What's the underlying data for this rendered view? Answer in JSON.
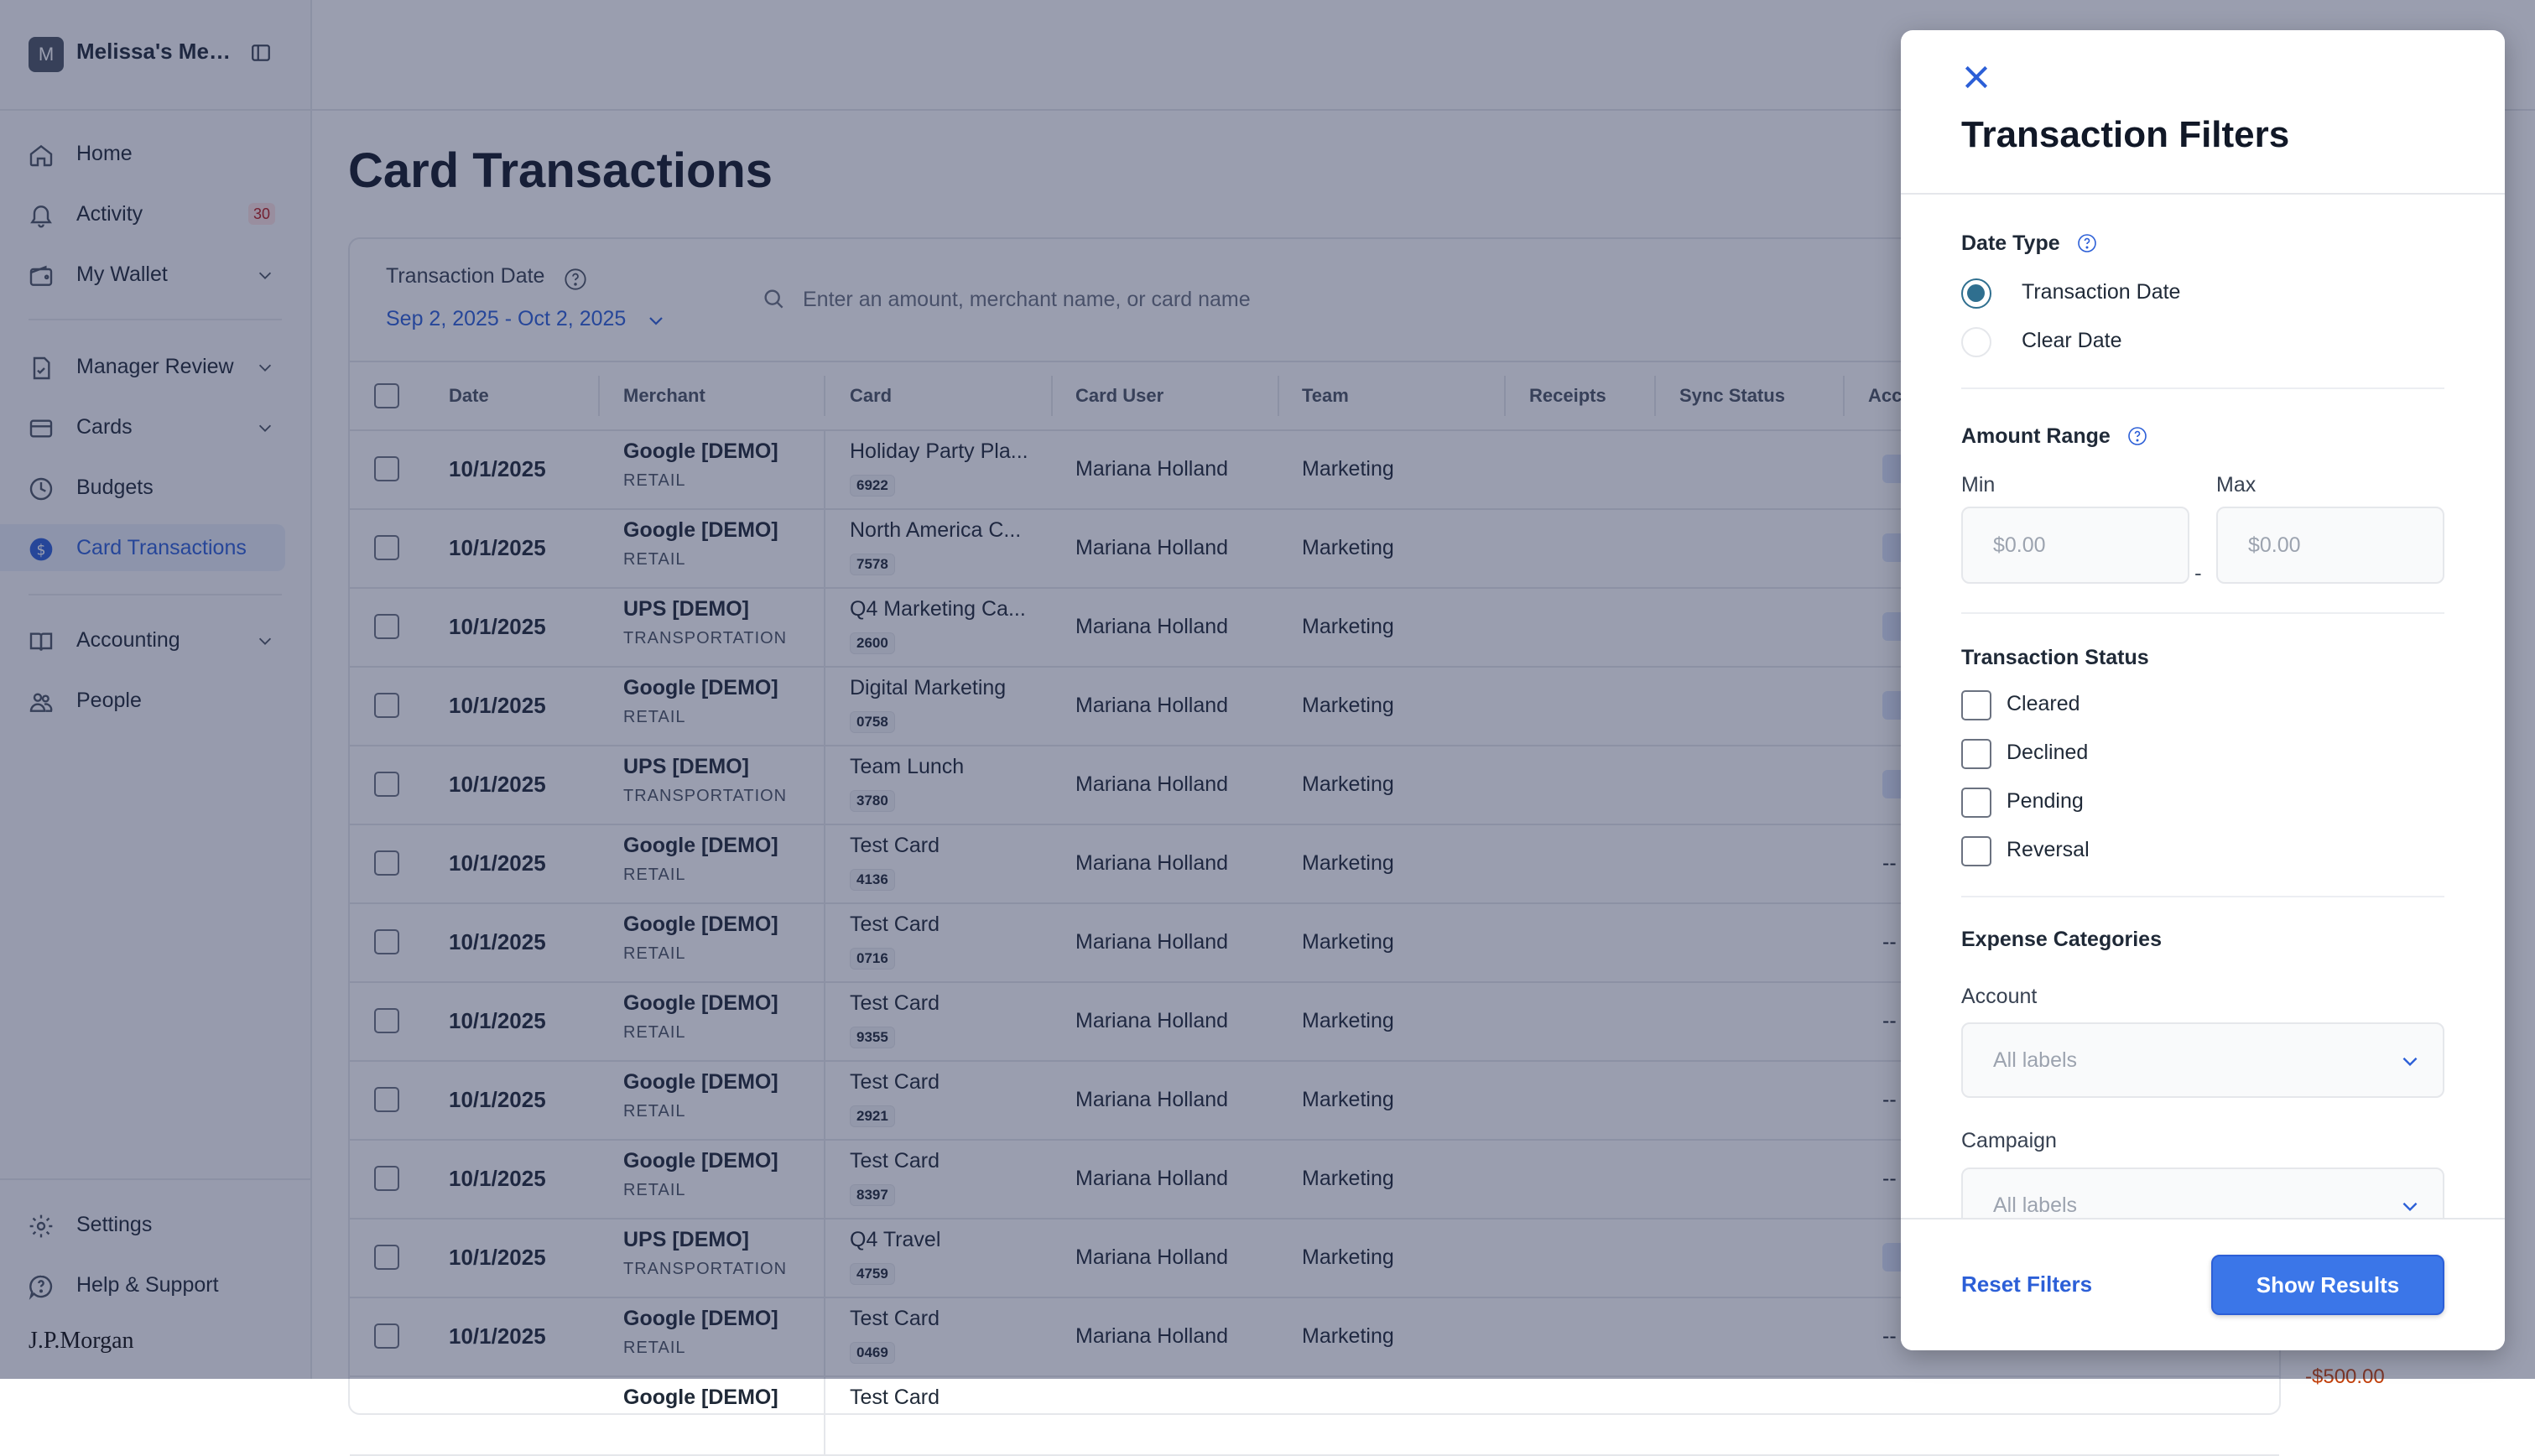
{
  "sidebar": {
    "org_initial": "M",
    "org_name": "Melissa's Mea...",
    "items": [
      {
        "label": "Home",
        "icon": "home-icon"
      },
      {
        "label": "Activity",
        "icon": "bell-icon",
        "badge": "30"
      },
      {
        "label": "My Wallet",
        "icon": "wallet-icon"
      },
      {
        "label": "Manager Review",
        "icon": "document-check-icon"
      },
      {
        "label": "Cards",
        "icon": "card-icon"
      },
      {
        "label": "Budgets",
        "icon": "pie-icon"
      },
      {
        "label": "Card Transactions",
        "icon": "dollar-circle-icon",
        "active": true
      },
      {
        "label": "Accounting",
        "icon": "book-icon"
      },
      {
        "label": "People",
        "icon": "people-icon"
      }
    ],
    "footer_items": [
      {
        "label": "Settings",
        "icon": "gear-icon"
      },
      {
        "label": "Help & Support",
        "icon": "help-icon"
      }
    ],
    "logo_text": "J.P.Morgan"
  },
  "page": {
    "title": "Card Transactions",
    "date_filter_label": "Transaction Date",
    "date_range": "Sep 2, 2025 - Oct 2, 2025",
    "search_placeholder": "Enter an amount, merchant name, or card name"
  },
  "table": {
    "columns": [
      "Date",
      "Merchant",
      "Card",
      "Card User",
      "Team",
      "Receipts",
      "Sync Status",
      "Acc"
    ],
    "rows": [
      {
        "date": "10/1/2025",
        "merchant": "Google [DEMO]",
        "category": "RETAIL",
        "card": "Holiday Party Pla...",
        "card_last4": "6922",
        "user": "Mariana Holland",
        "team": "Marketing",
        "acc": "badge"
      },
      {
        "date": "10/1/2025",
        "merchant": "Google [DEMO]",
        "category": "RETAIL",
        "card": "North America C...",
        "card_last4": "7578",
        "user": "Mariana Holland",
        "team": "Marketing",
        "acc": "badge"
      },
      {
        "date": "10/1/2025",
        "merchant": "UPS [DEMO]",
        "category": "TRANSPORTATION",
        "card": "Q4 Marketing Ca...",
        "card_last4": "2600",
        "user": "Mariana Holland",
        "team": "Marketing",
        "acc": "badge"
      },
      {
        "date": "10/1/2025",
        "merchant": "Google [DEMO]",
        "category": "RETAIL",
        "card": "Digital Marketing",
        "card_last4": "0758",
        "user": "Mariana Holland",
        "team": "Marketing",
        "acc": "badge"
      },
      {
        "date": "10/1/2025",
        "merchant": "UPS [DEMO]",
        "category": "TRANSPORTATION",
        "card": "Team Lunch",
        "card_last4": "3780",
        "user": "Mariana Holland",
        "team": "Marketing",
        "acc": "badge"
      },
      {
        "date": "10/1/2025",
        "merchant": "Google [DEMO]",
        "category": "RETAIL",
        "card": "Test Card",
        "card_last4": "4136",
        "user": "Mariana Holland",
        "team": "Marketing",
        "acc": "--"
      },
      {
        "date": "10/1/2025",
        "merchant": "Google [DEMO]",
        "category": "RETAIL",
        "card": "Test Card",
        "card_last4": "0716",
        "user": "Mariana Holland",
        "team": "Marketing",
        "acc": "--"
      },
      {
        "date": "10/1/2025",
        "merchant": "Google [DEMO]",
        "category": "RETAIL",
        "card": "Test Card",
        "card_last4": "9355",
        "user": "Mariana Holland",
        "team": "Marketing",
        "acc": "--"
      },
      {
        "date": "10/1/2025",
        "merchant": "Google [DEMO]",
        "category": "RETAIL",
        "card": "Test Card",
        "card_last4": "2921",
        "user": "Mariana Holland",
        "team": "Marketing",
        "acc": "--"
      },
      {
        "date": "10/1/2025",
        "merchant": "Google [DEMO]",
        "category": "RETAIL",
        "card": "Test Card",
        "card_last4": "8397",
        "user": "Mariana Holland",
        "team": "Marketing",
        "acc": "--"
      },
      {
        "date": "10/1/2025",
        "merchant": "UPS [DEMO]",
        "category": "TRANSPORTATION",
        "card": "Q4 Travel",
        "card_last4": "4759",
        "user": "Mariana Holland",
        "team": "Marketing",
        "acc": "badge"
      },
      {
        "date": "10/1/2025",
        "merchant": "Google [DEMO]",
        "category": "RETAIL",
        "card": "Test Card",
        "card_last4": "0469",
        "user": "Mariana Holland",
        "team": "Marketing",
        "acc": "--"
      },
      {
        "date": "",
        "merchant": "Google [DEMO]",
        "category": "",
        "card": "Test Card",
        "card_last4": "",
        "user": "",
        "team": "",
        "acc": ""
      }
    ],
    "partial_amount": "-$500.00"
  },
  "drawer": {
    "title": "Transaction Filters",
    "date_type": {
      "label": "Date Type",
      "options": [
        {
          "label": "Transaction Date",
          "selected": true
        },
        {
          "label": "Clear Date",
          "selected": false
        }
      ]
    },
    "amount_range": {
      "label": "Amount Range",
      "min_label": "Min",
      "max_label": "Max",
      "min_placeholder": "$0.00",
      "max_placeholder": "$0.00",
      "separator": "-"
    },
    "transaction_status": {
      "label": "Transaction Status",
      "options": [
        {
          "label": "Cleared",
          "checked": false
        },
        {
          "label": "Declined",
          "checked": false
        },
        {
          "label": "Pending",
          "checked": false
        },
        {
          "label": "Reversal",
          "checked": false
        }
      ]
    },
    "expense_categories": {
      "label": "Expense Categories",
      "account_label": "Account",
      "account_placeholder": "All labels",
      "campaign_label": "Campaign",
      "campaign_placeholder": "All labels"
    },
    "reset_label": "Reset Filters",
    "show_label": "Show Results"
  },
  "colors": {
    "accent": "#2c5fd7",
    "primary_button": "#3b76e8",
    "radio_selected": "#2f6f8f",
    "badge_bg": "#fde2e2",
    "badge_text": "#b91c1c",
    "overlay": "#1e294d"
  }
}
